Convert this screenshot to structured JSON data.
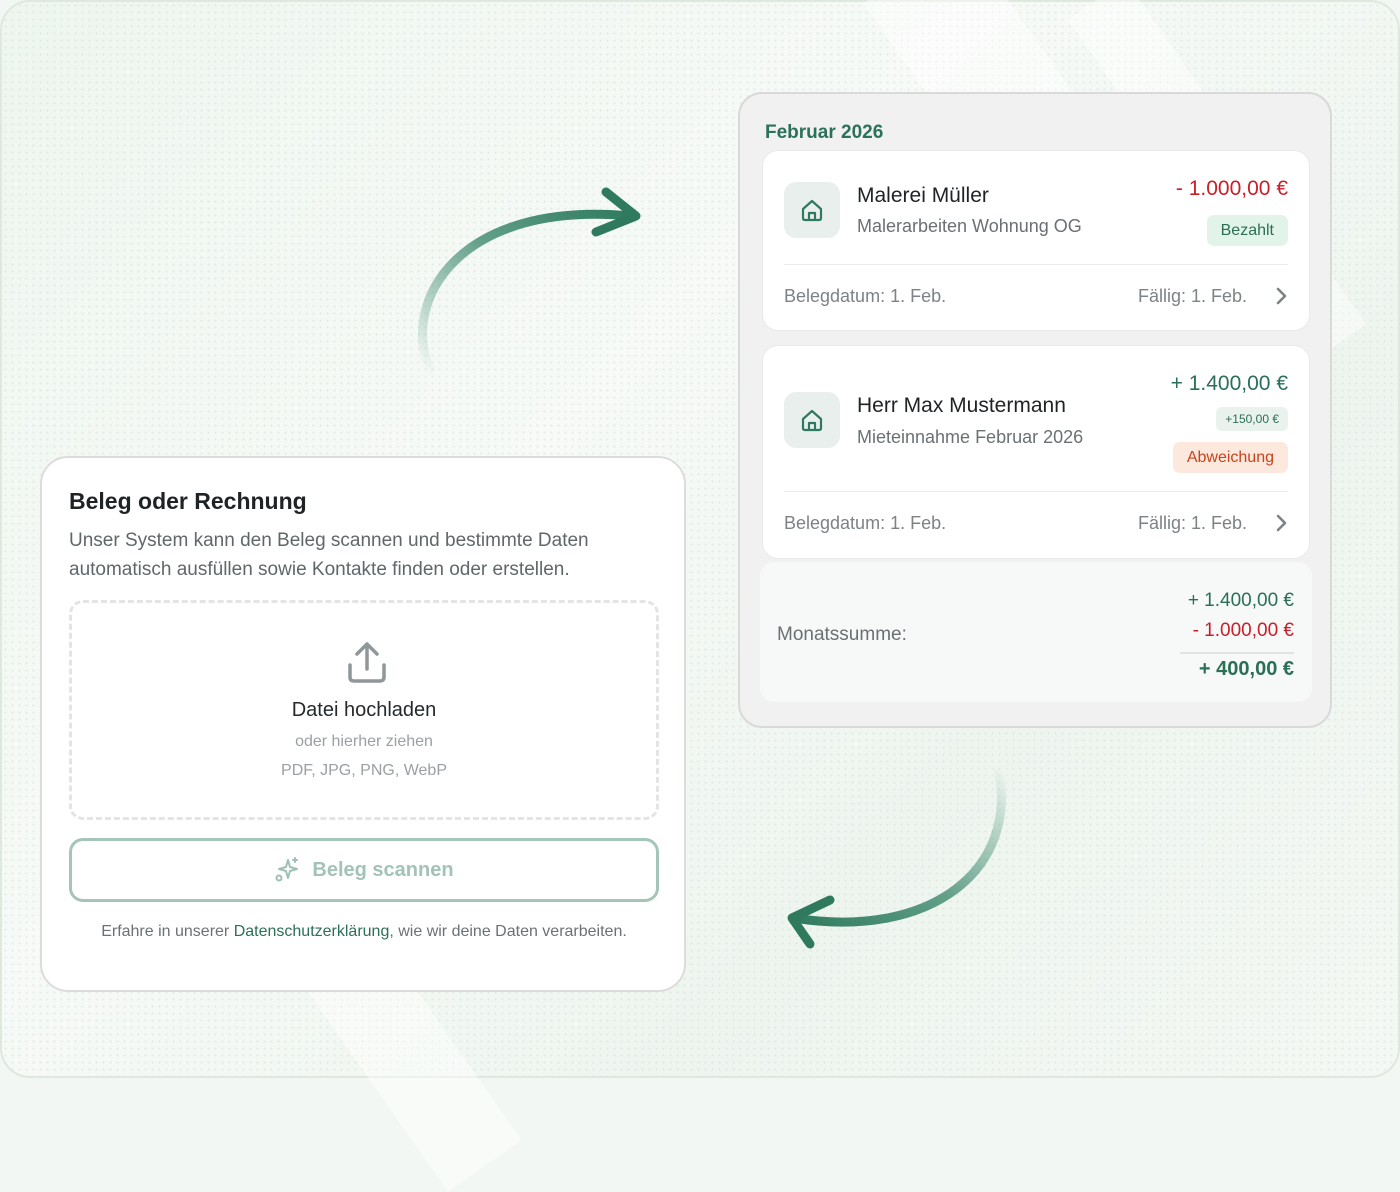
{
  "upload": {
    "title": "Beleg oder Rechnung",
    "description": "Unser System kann den Beleg scannen und bestimmte Daten automatisch ausfüllen sowie Kontakte finden oder erstellen.",
    "dropzone_title": "Datei hochladen",
    "dropzone_hint": "oder hierher ziehen",
    "dropzone_formats": "PDF, JPG, PNG, WebP",
    "scan_button_label": "Beleg scannen",
    "privacy_prefix": "Erfahre in unserer ",
    "privacy_link": "Datenschutzerklärung",
    "privacy_suffix": ", wie wir deine Daten verarbeiten."
  },
  "panel": {
    "month": "Februar 2026",
    "transactions": [
      {
        "name": "Malerei Müller",
        "description": "Malerarbeiten Wohnung OG",
        "amount": "- 1.000,00 €",
        "status": "Bezahlt",
        "date": "Belegdatum: 1. Feb.",
        "due": "Fällig: 1. Feb."
      },
      {
        "name": "Herr Max Mustermann",
        "description": "Mieteinnahme Februar 2026",
        "amount": "+ 1.400,00 €",
        "difference": "+150,00 €",
        "status": "Abweichung",
        "date": "Belegdatum: 1. Feb.",
        "due": "Fällig: 1. Feb."
      }
    ],
    "summary": {
      "label": "Monatssumme:",
      "income": "+ 1.400,00 €",
      "expense": "- 1.000,00 €",
      "total": "+ 400,00 €"
    }
  },
  "icons": {
    "upload": "upload-icon",
    "scan": "sparkles-icon",
    "house": "house-icon",
    "chevron": "chevron-right-icon",
    "arrows": "curved-arrow-icon"
  },
  "colors": {
    "accent": "#2b7258",
    "negative": "#c8202a",
    "warning": "#c9431b"
  }
}
